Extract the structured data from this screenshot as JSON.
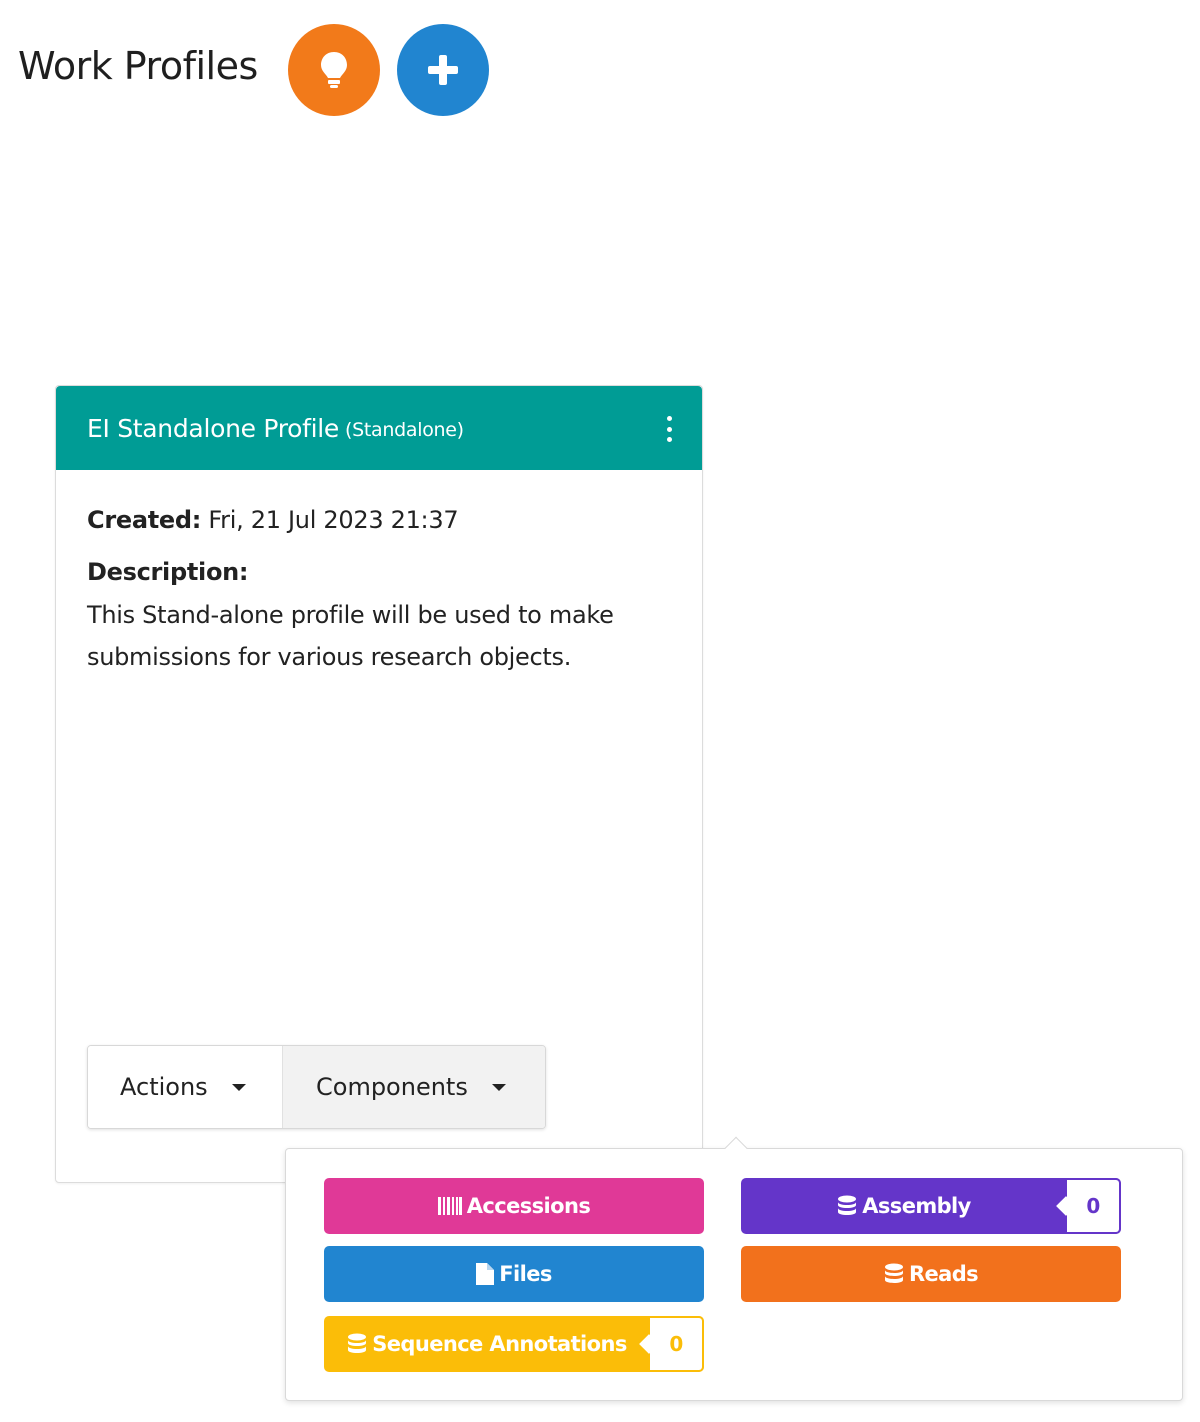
{
  "header": {
    "title": "Work Profiles",
    "tip_icon": "lightbulb-icon",
    "add_icon": "plus-icon"
  },
  "profile_card": {
    "title": "EI Standalone Profile",
    "type": "(Standalone)",
    "menu_icon": "ellipsis-vertical-icon",
    "created_label": "Created:",
    "created_value": "Fri, 21 Jul 2023 21:37",
    "description_label": "Description:",
    "description_text": "This Stand-alone profile will be used to make submissions for various research objects.",
    "actions_label": "Actions",
    "components_label": "Components"
  },
  "components_menu": {
    "items": [
      {
        "label": "Accessions",
        "icon": "barcode-icon",
        "color": "#e03997"
      },
      {
        "label": "Assembly",
        "icon": "database-icon",
        "color": "#6435c9",
        "count": "0"
      },
      {
        "label": "Files",
        "icon": "file-icon",
        "color": "#2185d0"
      },
      {
        "label": "Reads",
        "icon": "database-icon",
        "color": "#f2711c"
      },
      {
        "label": "Sequence Annotations",
        "icon": "database-icon",
        "color": "#fbbd08",
        "count": "0"
      }
    ]
  },
  "colors": {
    "header_teal": "#009c95",
    "tip_orange": "#f27a1a",
    "add_blue": "#2185d0"
  }
}
